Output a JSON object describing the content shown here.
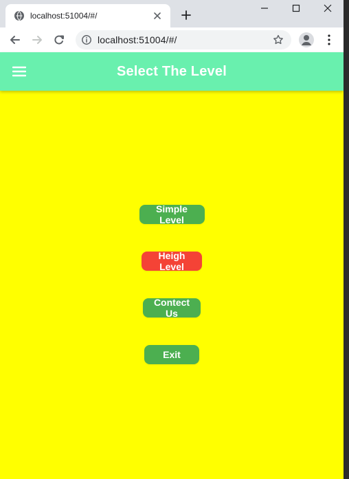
{
  "browser": {
    "tab": {
      "title": "localhost:51004/#/"
    },
    "address_bar": {
      "value": "localhost:51004/#/"
    },
    "icons": {
      "favicon": "globe-icon",
      "close": "close-icon",
      "new_tab": "plus-icon",
      "minimize": "minimize-icon",
      "maximize": "maximize-icon",
      "window_close": "x-icon",
      "back": "arrow-left-icon",
      "forward": "arrow-right-icon",
      "reload": "refresh-icon",
      "info": "info-icon",
      "bookmark": "star-icon",
      "profile": "avatar-icon",
      "menu": "kebab-icon"
    }
  },
  "app": {
    "appbar": {
      "title": "Select The Level",
      "menu_icon": "hamburger-icon"
    },
    "buttons": {
      "simple_level": "Simple Level",
      "heigh_level": "Heigh Level",
      "contect_us": "Contect Us",
      "exit": "Exit"
    },
    "colors": {
      "appbar": "#69f0ae",
      "background": "#ffff00",
      "green_button": "#4caf50",
      "red_button": "#f44336"
    }
  }
}
